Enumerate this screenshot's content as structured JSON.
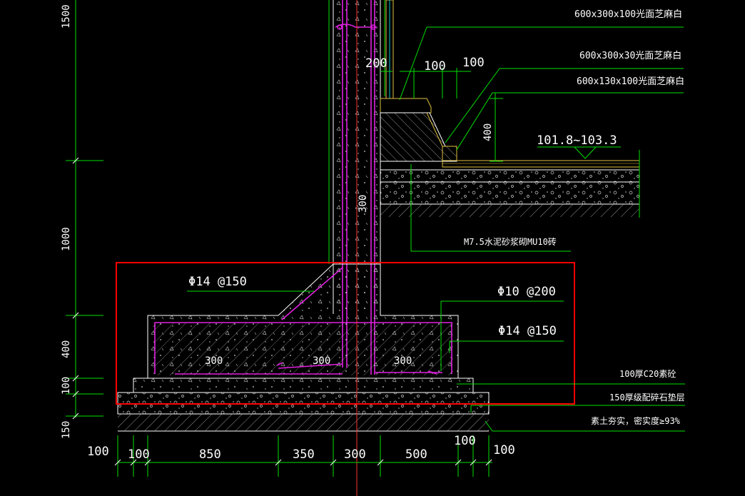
{
  "colors": {
    "background": "#000000",
    "dimension": "#00e000",
    "outline": "#ffffff",
    "rebar": "#e020e0",
    "paving": "#e0c040",
    "highlight": "#ff0000",
    "centerline": "#ff3030",
    "leader": "#00c8c8"
  },
  "annotations": {
    "tile_1": "600x300x100光面芝麻白",
    "tile_2": "600x300x30光面芝麻白",
    "tile_3": "600x130x100光面芝麻白",
    "elevation": "101.8~103.3",
    "masonry": "M7.5水泥砂浆砌MU10砖",
    "bar_14_top": "Φ14 @150",
    "bar_10": "Φ10 @200",
    "bar_14_right": "Φ14 @150",
    "c20_layer": "100厚C20素砼",
    "gravel_layer": "150厚级配碎石垫层",
    "soil": "素土夯实，密实度≥93%"
  },
  "dims": {
    "wall_200": "200",
    "curb_100a": "100",
    "curb_100b": "100",
    "curb_400": "400",
    "wall_300": "300",
    "base_300_left": "300",
    "base_300_mid": "300",
    "base_300_right": "300",
    "left_1500": "1500",
    "left_1000": "1000",
    "left_400": "400",
    "left_100": "100",
    "left_150": "150",
    "bottom": [
      "100",
      "100",
      "850",
      "350",
      "300",
      "500",
      "100",
      "100"
    ]
  }
}
